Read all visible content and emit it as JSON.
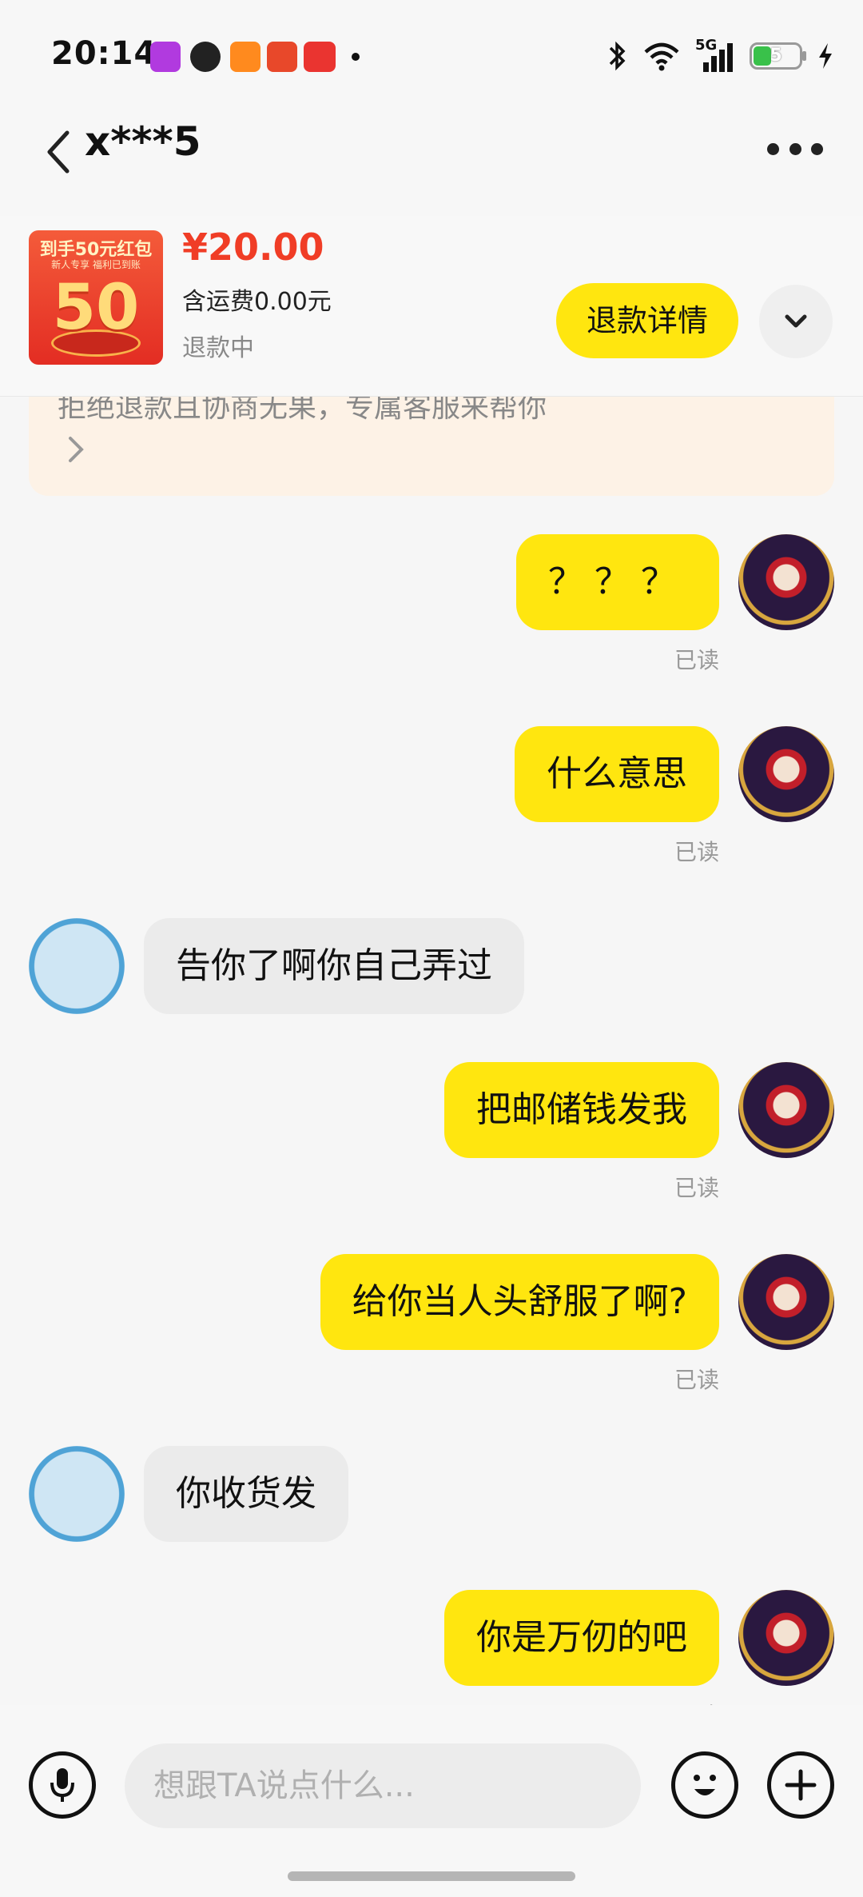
{
  "status_bar": {
    "time": "20:14",
    "network": "5G",
    "battery": "5"
  },
  "header": {
    "title": "x***5"
  },
  "order": {
    "thumb_title": "到手50元红包",
    "thumb_sub": "新人专享 福利已到账",
    "thumb_number": "50",
    "price": "¥20.00",
    "shipping": "含运费0.00元",
    "status": "退款中",
    "refund_button": "退款详情"
  },
  "notice": {
    "text": "拒绝退款且协商无果，专属客服来帮你"
  },
  "messages": [
    {
      "from": "me",
      "text": "？？？",
      "read": "已读"
    },
    {
      "from": "me",
      "text": "什么意思",
      "read": "已读"
    },
    {
      "from": "them",
      "text": "告你了啊你自己弄过"
    },
    {
      "from": "me",
      "text": "把邮储钱发我",
      "read": "已读"
    },
    {
      "from": "me",
      "text": "给你当人头舒服了啊?",
      "read": "已读"
    },
    {
      "from": "them",
      "text": "你收货发"
    },
    {
      "from": "me",
      "text": "你是万仞的吧",
      "read": "已读"
    }
  ],
  "input": {
    "placeholder": "想跟TA说点什么..."
  },
  "colors": {
    "accent_yellow": "#ffe60f",
    "price_red": "#f03d26"
  }
}
